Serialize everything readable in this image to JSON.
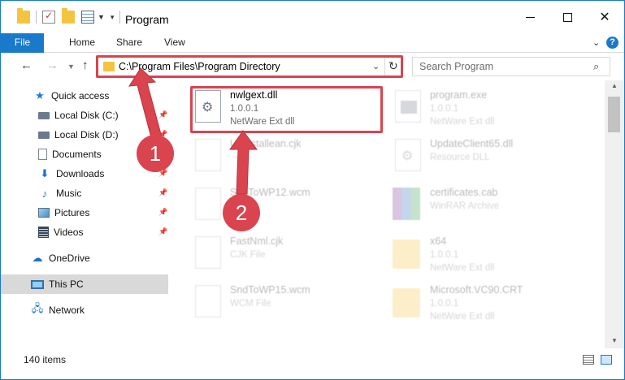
{
  "window": {
    "title": "Program",
    "min_glyph": "—",
    "close_glyph": "✕"
  },
  "ribbon": {
    "tabs": [
      "File",
      "Home",
      "Share",
      "View"
    ],
    "help_glyph": "?"
  },
  "nav": {
    "address": "C:\\Program Files\\Program Directory",
    "search_placeholder": "Search Program"
  },
  "sidebar": {
    "items": [
      {
        "label": "Quick access",
        "icon": "star-icon"
      },
      {
        "label": "Local Disk (C:)",
        "icon": "drive-icon",
        "pinned": true
      },
      {
        "label": "Local Disk (D:)",
        "icon": "drive-icon",
        "pinned": true
      },
      {
        "label": "Documents",
        "icon": "documents-icon",
        "pinned": true
      },
      {
        "label": "Downloads",
        "icon": "download-icon",
        "pinned": true
      },
      {
        "label": "Music",
        "icon": "music-icon",
        "pinned": true
      },
      {
        "label": "Pictures",
        "icon": "pictures-icon",
        "pinned": true
      },
      {
        "label": "Videos",
        "icon": "videos-icon",
        "pinned": true
      },
      {
        "label": "OneDrive",
        "icon": "cloud-icon"
      },
      {
        "label": "This PC",
        "icon": "computer-icon",
        "selected": true
      },
      {
        "label": "Network",
        "icon": "network-icon"
      }
    ]
  },
  "files": [
    {
      "name": "nwlgext.dll",
      "line2": "1.0.0.1",
      "line3": "NetWare Ext dll",
      "icon": "dll-file-icon",
      "highlighted": true
    },
    {
      "name": "program.exe",
      "line2": "1.0.0.1",
      "line3": "NetWare Ext dll",
      "icon": "exe-file-icon"
    },
    {
      "name": "Uninstallean.cjk",
      "line2": "",
      "line3": "",
      "icon": "blank-file-icon"
    },
    {
      "name": "UpdateClient65.dll",
      "line2": "Resource DLL",
      "line3": "",
      "icon": "dll-file-icon"
    },
    {
      "name": "SndToWP12.wcm",
      "line2": "",
      "line3": "",
      "icon": "blank-file-icon"
    },
    {
      "name": "certificates.cab",
      "line2": "WinRAR Archive",
      "line3": "",
      "icon": "winrar-icon"
    },
    {
      "name": "FastNml.cjk",
      "line2": "CJK File",
      "line3": "",
      "icon": "blank-file-icon"
    },
    {
      "name": "x64",
      "line2": "1.0.0.1",
      "line3": "NetWare Ext dll",
      "icon": "folder-icon"
    },
    {
      "name": "SndToWP15.wcm",
      "line2": "WCM File",
      "line3": "",
      "icon": "blank-file-icon"
    },
    {
      "name": "Microsoft.VC90.CRT",
      "line2": "1.0.0.1",
      "line3": "NetWare Ext dll",
      "icon": "folder-icon"
    }
  ],
  "status": {
    "item_count": "140 items"
  },
  "annotations": {
    "step1": "1",
    "step2": "2",
    "color": "#d9444f"
  },
  "colors": {
    "accent": "#1979ca",
    "selection": "#cce8ff"
  }
}
